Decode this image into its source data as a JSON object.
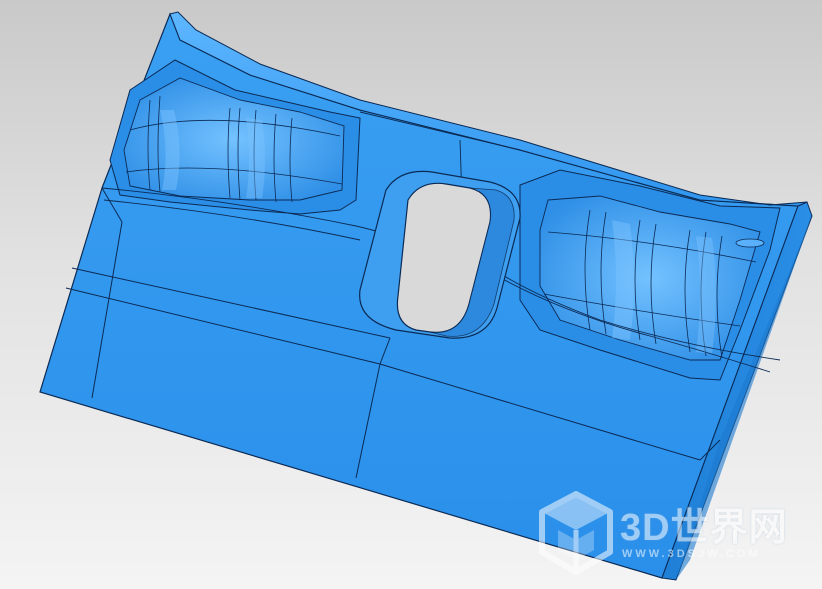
{
  "viewport": {
    "background_top": "#c9c9c9",
    "background_bottom": "#f4f4f4"
  },
  "model": {
    "face_color": "#2f95ee",
    "edge_color": "#0b2a55",
    "highlight_color": "#7cc4ff",
    "shadow_color": "#1d72c4"
  },
  "watermark": {
    "title": "3D世界网",
    "url": "WWW.3DSJW.COM",
    "icon": "cube-logo-icon"
  }
}
